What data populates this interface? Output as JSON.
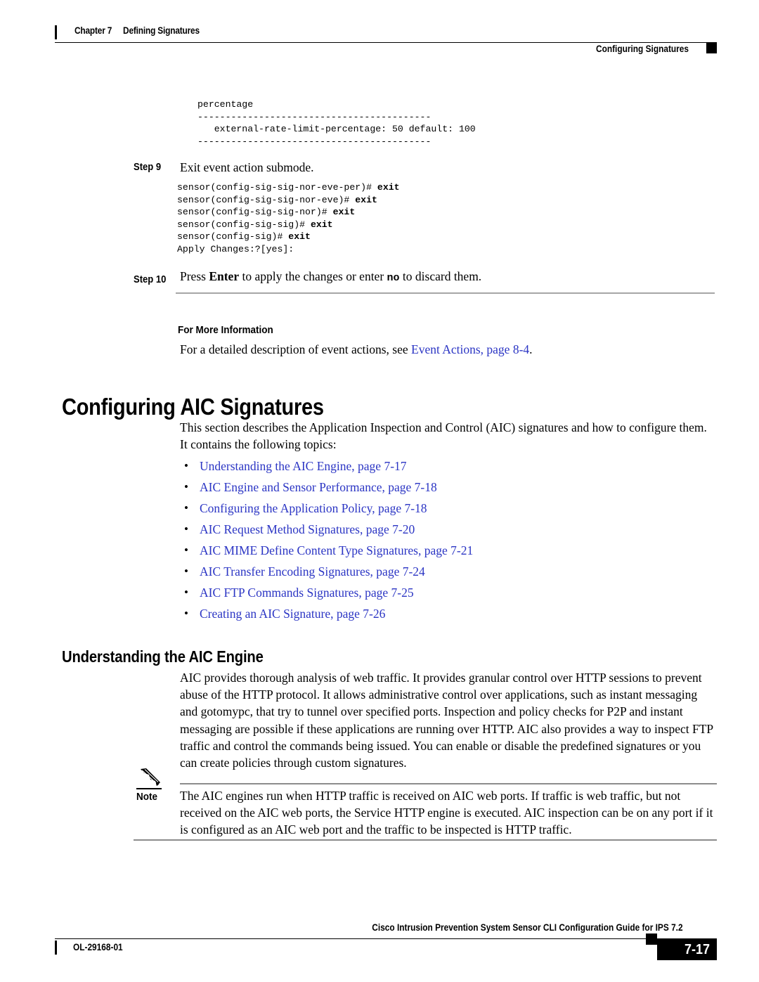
{
  "header": {
    "chapter": "Chapter 7",
    "chapter_title": "Defining Signatures",
    "section": "Configuring Signatures"
  },
  "code_top": "percentage\n------------------------------------------\n   external-rate-limit-percentage: 50 default: 100\n------------------------------------------",
  "step9": {
    "label": "Step 9",
    "text": "Exit event action submode.",
    "code_line1_prompt": "sensor(config-sig-sig-nor-eve-per)# ",
    "code_line1_cmd": "exit",
    "code_line2_prompt": "sensor(config-sig-sig-nor-eve)# ",
    "code_line2_cmd": "exit",
    "code_line3_prompt": "sensor(config-sig-sig-nor)# ",
    "code_line3_cmd": "exit",
    "code_line4_prompt": "sensor(config-sig-sig)# ",
    "code_line4_cmd": "exit",
    "code_line5_prompt": "sensor(config-sig)# ",
    "code_line5_cmd": "exit",
    "code_line6": "Apply Changes:?[yes]:"
  },
  "step10": {
    "label": "Step 10",
    "text_part1": "Press ",
    "text_key": "Enter",
    "text_part2": " to apply the changes or enter ",
    "text_no": "no",
    "text_part3": " to discard them."
  },
  "for_more_information": {
    "label": "For More Information",
    "text_prefix": "For a detailed description of event actions, see ",
    "link": "Event Actions, page 8-4",
    "text_suffix": "."
  },
  "section_heading": "Configuring AIC Signatures",
  "section_intro": "This section describes the Application Inspection and Control (AIC) signatures and how to configure them. It contains the following topics:",
  "topics": [
    "Understanding the AIC Engine, page 7-17",
    "AIC Engine and Sensor Performance, page 7-18",
    "Configuring the Application Policy, page 7-18",
    "AIC Request Method Signatures, page 7-20",
    "AIC MIME Define Content Type Signatures, page 7-21",
    "AIC Transfer Encoding Signatures, page 7-24",
    "AIC FTP Commands Signatures, page 7-25",
    "Creating an AIC Signature, page 7-26"
  ],
  "subsection_heading": "Understanding the AIC Engine",
  "subsection_body": "AIC provides thorough analysis of web traffic. It provides granular control over HTTP sessions to prevent abuse of the HTTP protocol. It allows administrative control over applications, such as instant messaging and gotomypc, that try to tunnel over specified ports. Inspection and policy checks for P2P and instant messaging are possible if these applications are running over HTTP. AIC also provides a way to inspect FTP traffic and control the commands being issued. You can enable or disable the predefined signatures or you can create policies through custom signatures.",
  "note": {
    "label": "Note",
    "icon": "pencil-icon",
    "text": "The AIC engines run when HTTP traffic is received on AIC web ports. If traffic is web traffic, but not received on the AIC web ports, the Service HTTP engine is executed. AIC inspection can be on any port if it is configured as an AIC web port and the traffic to be inspected is HTTP traffic."
  },
  "footer": {
    "title": "Cisco Intrusion Prevention System Sensor CLI Configuration Guide for IPS 7.2",
    "doc_id": "OL-29168-01",
    "page_number": "7-17"
  },
  "colors": {
    "link": "#2B35C4",
    "rule_gray": "#a6a6a6",
    "text": "#000000"
  }
}
